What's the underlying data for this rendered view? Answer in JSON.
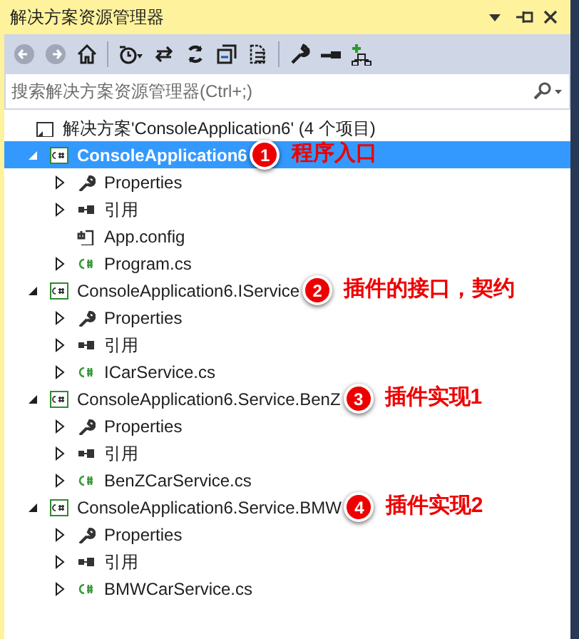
{
  "window": {
    "title": "解决方案资源管理器",
    "buttons": [
      {
        "kind": "dropdown"
      },
      {
        "kind": "pin"
      },
      {
        "kind": "close"
      }
    ]
  },
  "toolbar": [
    {
      "kind": "back",
      "disabled": true
    },
    {
      "kind": "forward",
      "disabled": true
    },
    {
      "kind": "home",
      "disabled": false
    },
    {
      "kind": "separator"
    },
    {
      "kind": "history",
      "disabled": false
    },
    {
      "kind": "sync",
      "disabled": false
    },
    {
      "kind": "refresh",
      "disabled": false
    },
    {
      "kind": "collapse",
      "disabled": false
    },
    {
      "kind": "show-files",
      "disabled": false
    },
    {
      "kind": "separator"
    },
    {
      "kind": "properties",
      "disabled": false
    },
    {
      "kind": "preview",
      "disabled": false
    },
    {
      "kind": "diagram",
      "disabled": false
    }
  ],
  "search": {
    "placeholder": "搜索解决方案资源管理器(Ctrl+;)"
  },
  "tree": {
    "label": "解决方案'ConsoleApplication6' (4 个项目)",
    "children": [
      {
        "label": "ConsoleApplication6",
        "selected": true,
        "expanded": true,
        "annotation": {
          "number": "1",
          "text": "程序入口"
        },
        "children": [
          {
            "kind": "properties",
            "label": "Properties",
            "expanded": false
          },
          {
            "kind": "references",
            "label": "引用",
            "expanded": false
          },
          {
            "kind": "config",
            "label": "App.config"
          },
          {
            "kind": "csharp",
            "label": "Program.cs",
            "expanded": false
          }
        ]
      },
      {
        "label": "ConsoleApplication6.IService",
        "selected": false,
        "expanded": true,
        "annotation": {
          "number": "2",
          "text": "插件的接口，契约"
        },
        "children": [
          {
            "kind": "properties",
            "label": "Properties",
            "expanded": false
          },
          {
            "kind": "references",
            "label": "引用",
            "expanded": false
          },
          {
            "kind": "csharp",
            "label": "ICarService.cs",
            "expanded": false
          }
        ]
      },
      {
        "label": "ConsoleApplication6.Service.BenZ",
        "selected": false,
        "expanded": true,
        "annotation": {
          "number": "3",
          "text": "插件实现1"
        },
        "children": [
          {
            "kind": "properties",
            "label": "Properties",
            "expanded": false
          },
          {
            "kind": "references",
            "label": "引用",
            "expanded": false
          },
          {
            "kind": "csharp",
            "label": "BenZCarService.cs",
            "expanded": false
          }
        ]
      },
      {
        "label": "ConsoleApplication6.Service.BMW",
        "selected": false,
        "expanded": true,
        "annotation": {
          "number": "4",
          "text": "插件实现2"
        },
        "children": [
          {
            "kind": "properties",
            "label": "Properties",
            "expanded": false
          },
          {
            "kind": "references",
            "label": "引用",
            "expanded": false
          },
          {
            "kind": "csharp",
            "label": "BMWCarService.cs",
            "expanded": false
          }
        ]
      }
    ]
  }
}
